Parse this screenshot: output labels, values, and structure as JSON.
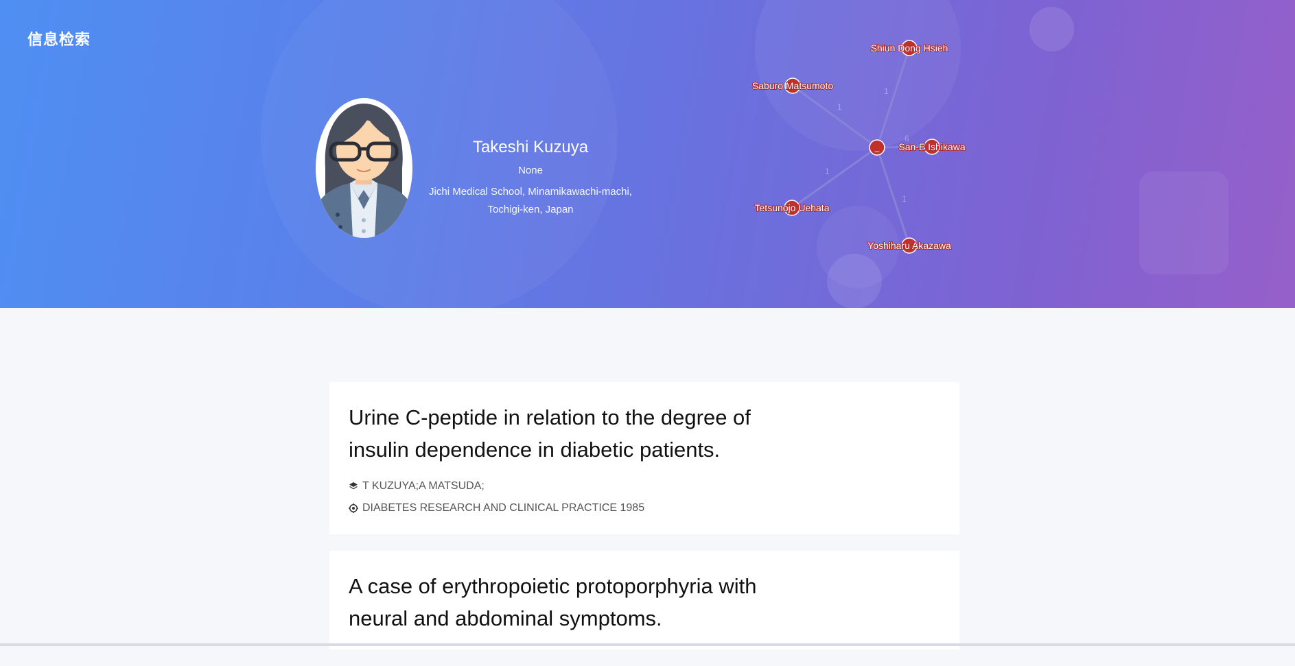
{
  "brand": "信息检索",
  "profile": {
    "name": "Takeshi Kuzuya",
    "title": "None",
    "org_line1": "Jichi Medical School, Minamikawachi-machi,",
    "org_line2": "Tochigi-ken, Japan"
  },
  "graph": {
    "center_label": "_",
    "nodes": [
      {
        "name": "Shiun Dong Hsieh",
        "weight": "1"
      },
      {
        "name": "Saburo Matsumoto",
        "weight": "1"
      },
      {
        "name": "San-E Ishikawa",
        "weight": "6"
      },
      {
        "name": "Tetsunojo Uehata",
        "weight": "1"
      },
      {
        "name": "Yoshiharu Akazawa",
        "weight": "1"
      }
    ],
    "accent": "#c0312c"
  },
  "papers": [
    {
      "title": "Urine C-peptide in relation to the degree of insulin dependence in diabetic patients.",
      "authors": "T KUZUYA;A MATSUDA;",
      "venue": "DIABETES RESEARCH AND CLINICAL PRACTICE 1985"
    },
    {
      "title": "A case of erythropoietic protoporphyria with neural and abdominal symptoms."
    }
  ],
  "icons": {
    "authors": "layers-icon",
    "venue": "target-icon"
  }
}
